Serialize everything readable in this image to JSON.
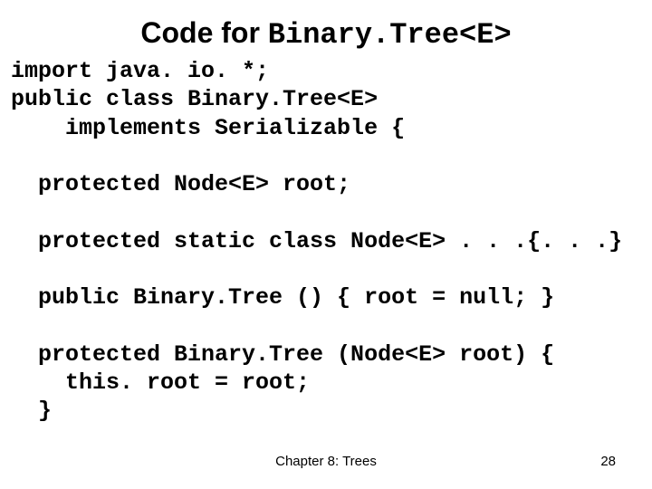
{
  "title": {
    "prefix": "Code for ",
    "classname": "Binary.Tree<E>"
  },
  "code": {
    "l1": "import java. io. *;",
    "l2": "public class Binary.Tree<E>",
    "l3": "    implements Serializable {",
    "l4": "",
    "l5": "  protected Node<E> root;",
    "l6": "",
    "l7": "  protected static class Node<E> . . .{. . .}",
    "l8": "",
    "l9": "  public Binary.Tree () { root = null; }",
    "l10": "",
    "l11": "  protected Binary.Tree (Node<E> root) {",
    "l12": "    this. root = root;",
    "l13": "  }"
  },
  "footer": {
    "chapter": "Chapter 8: Trees",
    "page": "28"
  }
}
